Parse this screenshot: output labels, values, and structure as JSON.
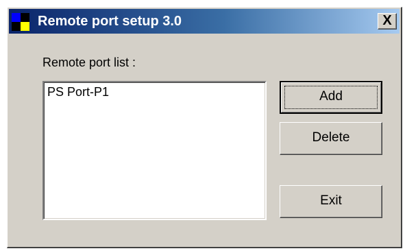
{
  "window": {
    "title": "Remote port setup 3.0",
    "close_label": "X",
    "icon_colors": [
      "#0000ff",
      "#ffff00",
      "#000000",
      "#0000ff"
    ]
  },
  "list": {
    "label": "Remote port list :",
    "items": [
      "PS Port-P1"
    ]
  },
  "buttons": {
    "add": "Add",
    "delete": "Delete",
    "exit": "Exit"
  }
}
